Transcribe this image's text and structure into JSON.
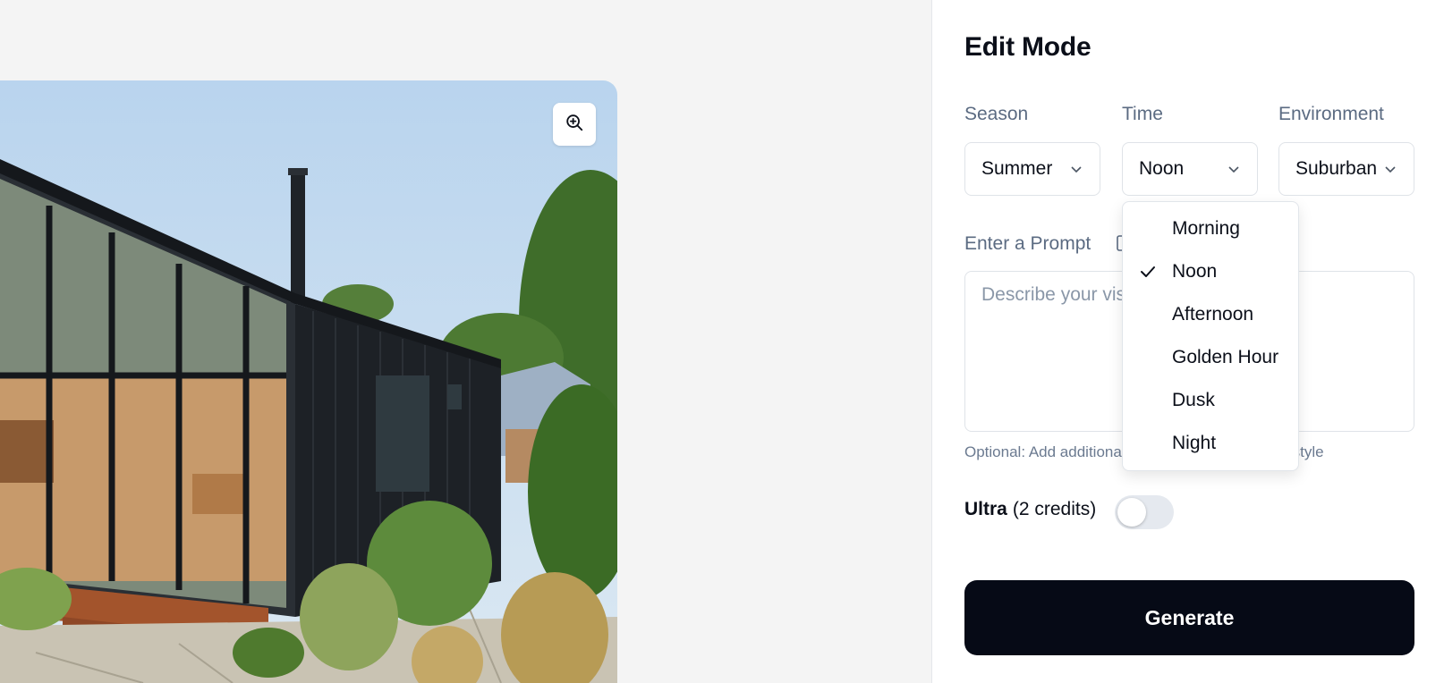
{
  "panel": {
    "title": "Edit Mode",
    "season": {
      "label": "Season",
      "value": "Summer"
    },
    "time": {
      "label": "Time",
      "value": "Noon"
    },
    "environment": {
      "label": "Environment",
      "value": "Suburban"
    },
    "prompt": {
      "label": "Enter a Prompt",
      "placeholder": "Describe your vision...",
      "hint": "Optional: Add additional details to customize the style"
    },
    "ultra": {
      "label": "Ultra",
      "credits": "(2 credits)",
      "enabled": false
    },
    "generate_label": "Generate"
  },
  "time_menu": {
    "options": [
      "Morning",
      "Noon",
      "Afternoon",
      "Golden Hour",
      "Dusk",
      "Night"
    ],
    "selected": "Noon"
  },
  "icons": {
    "zoom": "zoom-in-icon",
    "chevron": "chevron-down-icon",
    "prompt_info": "info-icon",
    "check": "check-icon"
  },
  "colors": {
    "accent": "#060a16",
    "label": "#5b6b82",
    "border": "#dfe3e8",
    "background": "#f4f4f4"
  }
}
